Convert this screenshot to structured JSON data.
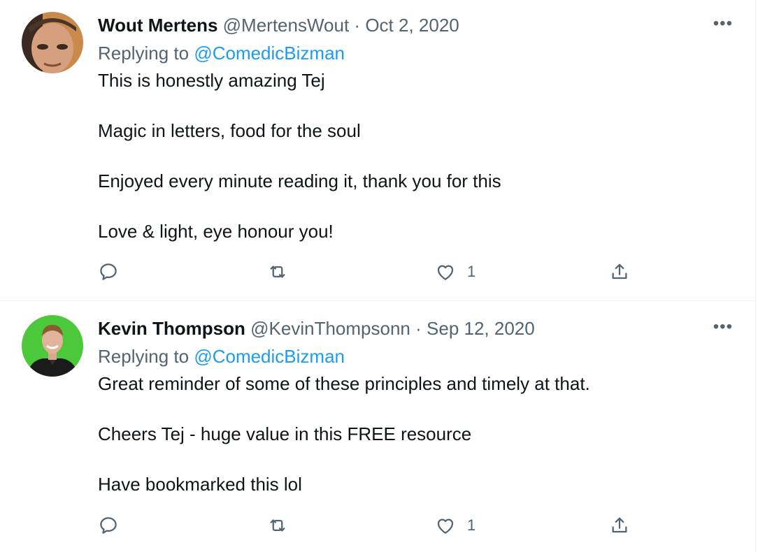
{
  "tweets": [
    {
      "name": "Wout Mertens",
      "handle": "@MertensWout",
      "separator": "·",
      "date": "Oct 2, 2020",
      "more_label": "•••",
      "replying_prefix": "Replying to",
      "replying_to": "@ComedicBizman",
      "lines": [
        "This is honestly amazing Tej",
        "Magic in letters, food for the soul",
        "Enjoyed every minute reading it, thank you for this",
        "Love & light, eye honour you!"
      ],
      "likes": "1",
      "avatar_colors": {
        "bg": "#c98a4b",
        "skin": "#d6a07e",
        "hair": "#4a3528"
      }
    },
    {
      "name": "Kevin Thompson",
      "handle": "@KevinThompsonn",
      "separator": "·",
      "date": "Sep 12, 2020",
      "more_label": "•••",
      "replying_prefix": "Replying to",
      "replying_to": "@ComedicBizman",
      "lines": [
        "Great reminder of some of these principles and timely at that.",
        "Cheers Tej - huge value in this FREE resource",
        "Have bookmarked this lol"
      ],
      "likes": "1",
      "avatar_colors": {
        "bg": "#4cc93a",
        "skin": "#e2b39a",
        "hair": "#8a5a33",
        "shirt": "#1b1b1b"
      }
    }
  ],
  "icons": {
    "reply": "reply-icon",
    "retweet": "retweet-icon",
    "like": "heart-icon",
    "share": "share-icon",
    "more": "more-options-icon"
  },
  "colors": {
    "text": "#0f1419",
    "secondary": "#536471",
    "accent": "#1d9bf0",
    "divider": "#eff3f4"
  }
}
